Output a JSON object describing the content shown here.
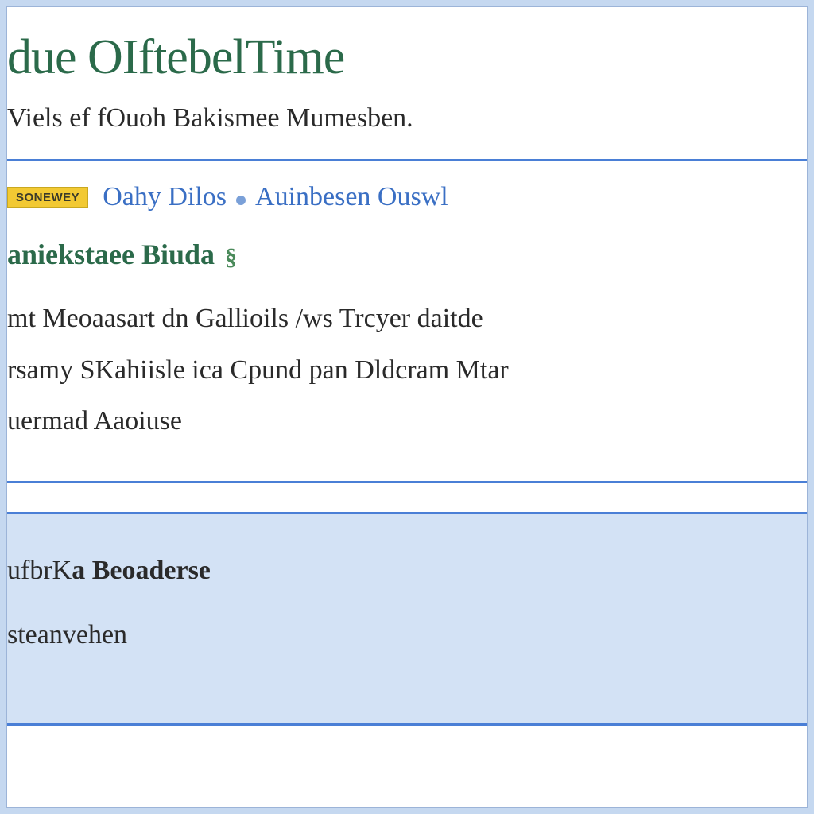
{
  "header": {
    "title": "due OIftebelTime",
    "subtitle": "Viels ef fOuoh Bakismee Mumesben."
  },
  "section1": {
    "badge_label": "SONEWEY",
    "link_text_1": "Oahy Dilos",
    "link_text_2": "Auinbesen Ouswl",
    "dot_icon": "dot-icon",
    "subheading": "aniekstaee Biuda",
    "subheading_symbol": "§",
    "body_line_1": "mt Meoaasart dn Gallioils /ws Trcyer daitde",
    "body_line_2": "rsamy SKahiisle ica Cpund pan Dldcram Mtar",
    "body_line_3": "uermad Aaoiuse"
  },
  "footer": {
    "line_1_prefix": "ufbrK",
    "line_1_bold": "a Beoaderse",
    "line_2": "steanvehen"
  },
  "colors": {
    "accent_green": "#2b6a4a",
    "link_blue": "#3a6fc4",
    "rule_blue": "#4a7fd6",
    "badge_yellow": "#f2c933",
    "footer_bg": "#d3e2f5"
  }
}
